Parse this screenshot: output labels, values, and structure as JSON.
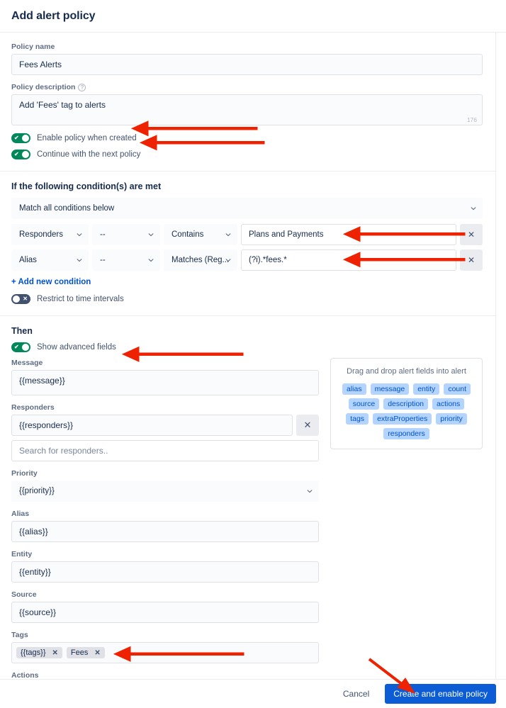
{
  "header": {
    "title": "Add alert policy"
  },
  "policy": {
    "name_label": "Policy name",
    "name_value": "Fees Alerts",
    "description_label": "Policy description",
    "description_value": "Add 'Fees' tag to alerts",
    "description_char_count": "176",
    "help_icon": "help-circle-icon",
    "toggles": [
      {
        "label": "Enable policy when created",
        "state": "on"
      },
      {
        "label": "Continue with the next policy",
        "state": "on"
      }
    ]
  },
  "conditions": {
    "heading": "If the following condition(s) are met",
    "match_mode": "Match all conditions below",
    "rows": [
      {
        "field": "Responders",
        "key": "--",
        "operator": "Contains",
        "value": "Plans and Payments",
        "remove_label": "✕"
      },
      {
        "field": "Alias",
        "key": "--",
        "operator": "Matches (Reg...",
        "value": "(?i).*fees.*",
        "remove_label": "✕"
      }
    ],
    "add_condition_label": "+ Add new condition",
    "restrict_toggle": {
      "label": "Restrict to time intervals",
      "state": "off"
    }
  },
  "then": {
    "heading": "Then",
    "advanced_toggle": {
      "label": "Show advanced fields",
      "state": "on"
    },
    "message_label": "Message",
    "message_value": "{{message}}",
    "responders_label": "Responders",
    "responders_value": "{{responders}}",
    "responders_remove_label": "✕",
    "responders_search_placeholder": "Search for responders..",
    "priority_label": "Priority",
    "priority_value": "{{priority}}",
    "alias_label": "Alias",
    "alias_value": "{{alias}}",
    "entity_label": "Entity",
    "entity_value": "{{entity}}",
    "source_label": "Source",
    "source_value": "{{source}}",
    "tags_label": "Tags",
    "tags": [
      {
        "label": "{{tags}}",
        "remove": "✕"
      },
      {
        "label": "Fees",
        "remove": "✕"
      }
    ],
    "actions_label_cut": "Actions"
  },
  "drag_panel": {
    "title": "Drag and drop alert fields into alert",
    "rows": [
      [
        "alias",
        "message",
        "entity",
        "count"
      ],
      [
        "source",
        "description",
        "actions"
      ],
      [
        "tags",
        "extraProperties",
        "priority"
      ],
      [
        "responders"
      ]
    ]
  },
  "footer": {
    "cancel_label": "Cancel",
    "submit_label": "Create and enable policy"
  },
  "colors": {
    "accent_blue": "#0B5CD5",
    "link_blue": "#0052CC",
    "toggle_on_green": "#00875A",
    "toggle_off_gray": "#42526E",
    "chip_blue_bg": "#B3D4FF",
    "annotation_red": "#EE2200",
    "text_dark": "#172B4D",
    "text_muted": "#5E6C84",
    "border": "#DFE1E6"
  }
}
